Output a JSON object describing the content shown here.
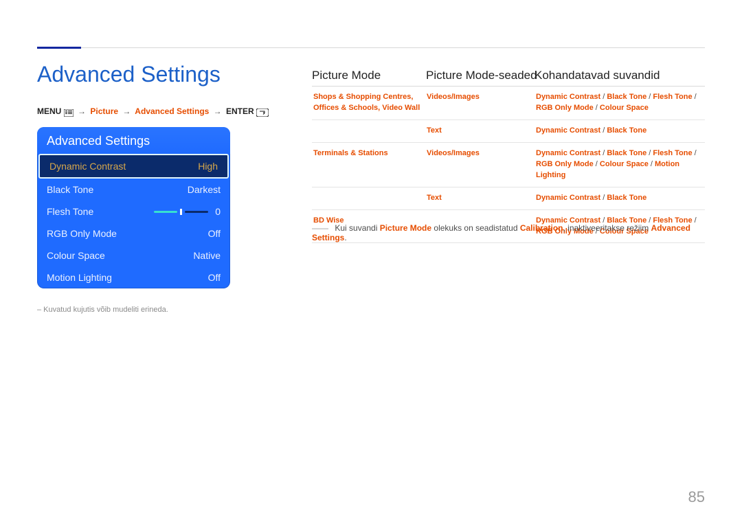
{
  "page": {
    "number": "85"
  },
  "header": {
    "title": "Advanced Settings"
  },
  "breadcrumb": {
    "menu_label": "MENU",
    "crumbs": [
      "Picture",
      "Advanced Settings"
    ],
    "enter_label": "ENTER"
  },
  "osd": {
    "title": "Advanced Settings",
    "rows": [
      {
        "label": "Dynamic Contrast",
        "value": "High",
        "selected": true
      },
      {
        "label": "Black Tone",
        "value": "Darkest"
      },
      {
        "label": "Flesh Tone",
        "value": "0",
        "slider": true
      },
      {
        "label": "RGB Only Mode",
        "value": "Off"
      },
      {
        "label": "Colour Space",
        "value": "Native"
      },
      {
        "label": "Motion Lighting",
        "value": "Off"
      }
    ],
    "caption": "–  Kuvatud kujutis võib mudeliti erineda."
  },
  "columns": {
    "c1": "Picture Mode",
    "c2": "Picture Mode-seaded",
    "c3": "Kohandatavad suvandid"
  },
  "rows": [
    {
      "mode": "Shops & Shopping Centres, Offices & Schools, Video Wall",
      "setting": "Videos/Images",
      "options": "Dynamic Contrast / Black Tone / Flesh Tone / RGB Only Mode / Colour Space"
    },
    {
      "mode": "",
      "setting": "Text",
      "options": "Dynamic Contrast / Black Tone"
    },
    {
      "mode": "Terminals & Stations",
      "setting": "Videos/Images",
      "options": "Dynamic Contrast / Black Tone / Flesh Tone / RGB Only Mode / Colour Space / Motion Lighting"
    },
    {
      "mode": "",
      "setting": "Text",
      "options": "Dynamic Contrast / Black Tone"
    },
    {
      "mode": "BD Wise",
      "setting": "",
      "options": "Dynamic Contrast / Black Tone / Flesh Tone / RGB Only Mode / Colour Space"
    }
  ],
  "note": {
    "prefix": "Kui suvandi ",
    "em1": "Picture Mode",
    "mid": " olekuks on seadistatud ",
    "em2": "Calibration",
    "suffix1": ", inaktiveeritakse režiim ",
    "em3": "Advanced Settings",
    "suffix2": "."
  }
}
